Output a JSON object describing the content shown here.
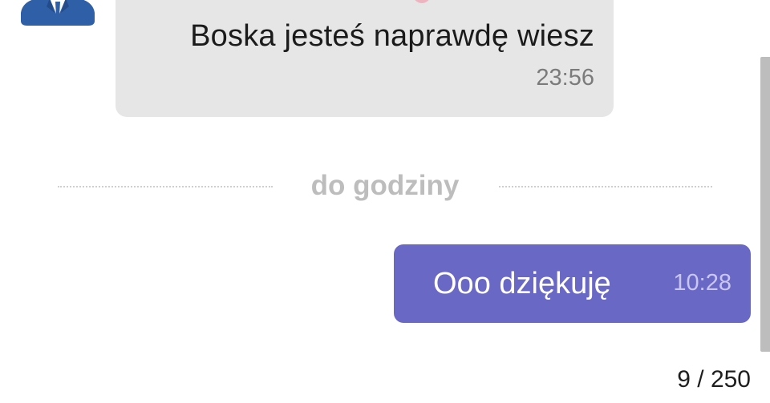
{
  "messages": [
    {
      "direction": "incoming",
      "text": "Boska jesteś naprawdę wiesz",
      "time": "23:56"
    },
    {
      "direction": "outgoing",
      "text": "Ooo dziękuję",
      "time": "10:28"
    }
  ],
  "divider": {
    "label": "do godziny"
  },
  "pager": {
    "counter": "9 / 250"
  },
  "colors": {
    "incoming_bubble": "#e6e6e6",
    "outgoing_bubble": "#6a68c5",
    "avatar_suit": "#2f5fa7",
    "divider_text": "#bdbdbd",
    "scrollbar": "#bdbdbd"
  },
  "icons": {
    "avatar": "person-in-suit-avatar-icon"
  }
}
